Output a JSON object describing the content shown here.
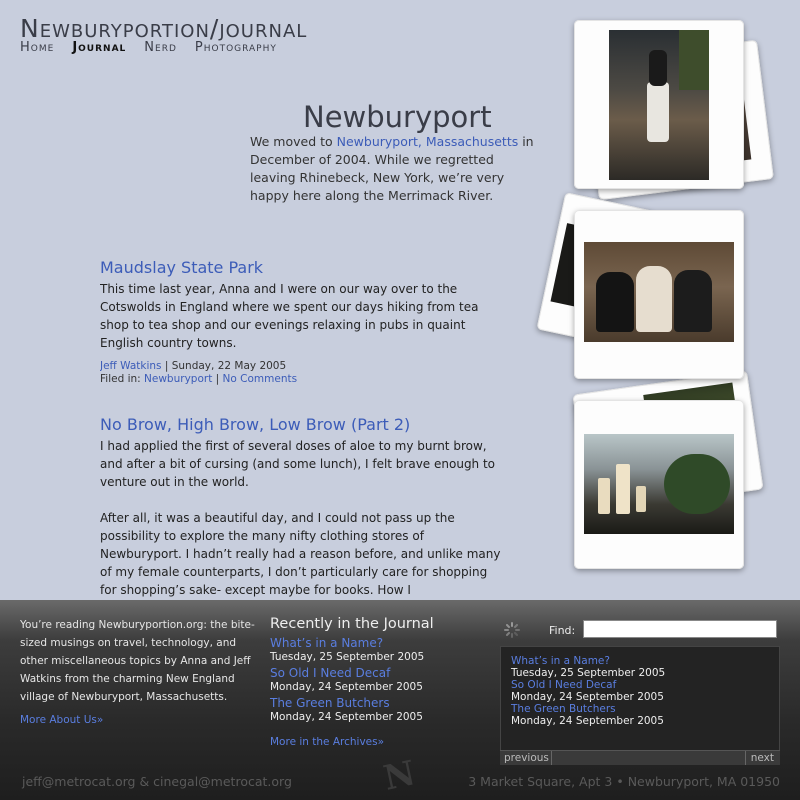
{
  "site": {
    "title": "Newburyportion/journal",
    "nav": [
      "Home",
      "Journal",
      "Nerd",
      "Photography"
    ],
    "active_nav": "Journal"
  },
  "intro": {
    "title": "Newburyport",
    "text_before": "We moved to ",
    "link": "Newburyport, Massachusetts",
    "text_after": " in December of 2004. While we regretted leaving Rhinebeck, New York, we’re very happy here along the Merrimack River."
  },
  "posts": [
    {
      "title": "Maudslay State Park",
      "paragraphs": [
        "This time last year, Anna and I were on our way over to the Cotswolds in England where we spent our days hiking from tea shop to tea shop and our evenings relaxing in pubs in quaint English country towns."
      ],
      "author": "Jeff Watkins",
      "date": "Sunday, 22 May 2005",
      "filed_label": "Filed in:",
      "category": "Newburyport",
      "comments": "No Comments"
    },
    {
      "title": "No Brow, High Brow, Low Brow (Part 2)",
      "paragraphs": [
        "I had applied the first of several doses of aloe to my burnt brow, and after a bit of cursing (and some lunch), I felt brave enough to venture out in the world.",
        "After all, it was a beautiful day, and I could not pass up the possibility to explore the many nifty clothing stores of Newburyport. I hadn’t really had a reason before, and unlike many of my female counterparts, I don’t particularly care for shopping for shopping’s sake- except maybe for books. How I"
      ]
    }
  ],
  "footer": {
    "about": "You’re reading Newburyportion.org: the bite-sized musings on travel, technology, and other miscellaneous topics by Anna and Jeff Watkins from the charming New England village of Newburyport, Massachusetts.",
    "about_link": "More About Us»",
    "recent_title": "Recently in the Journal",
    "recent": [
      {
        "title": "What’s in a Name?",
        "date": "Tuesday, 25 September 2005"
      },
      {
        "title": "So Old I Need Decaf",
        "date": "Monday, 24 September 2005"
      },
      {
        "title": "The Green Butchers",
        "date": "Monday, 24 September 2005"
      }
    ],
    "archive_link": "More in the Archives»",
    "find_label": "Find:",
    "find_value": "",
    "results": [
      {
        "title": "What’s in a Name?",
        "date": "Tuesday, 25 September 2005"
      },
      {
        "title": "So Old I Need Decaf",
        "date": "Monday, 24 September 2005"
      },
      {
        "title": "The Green Butchers",
        "date": "Monday, 24 September 2005"
      }
    ],
    "prev": "previous",
    "next": "next",
    "emails": "jeff@metrocat.org   &   cinegal@metrocat.org",
    "address": "3 Market Square, Apt 3 • Newburyport, MA 01950",
    "logo_letter": "N"
  },
  "colors": {
    "link": "#3c5cb8",
    "background": "#c8cedd",
    "footer": "#2a2a2a"
  }
}
